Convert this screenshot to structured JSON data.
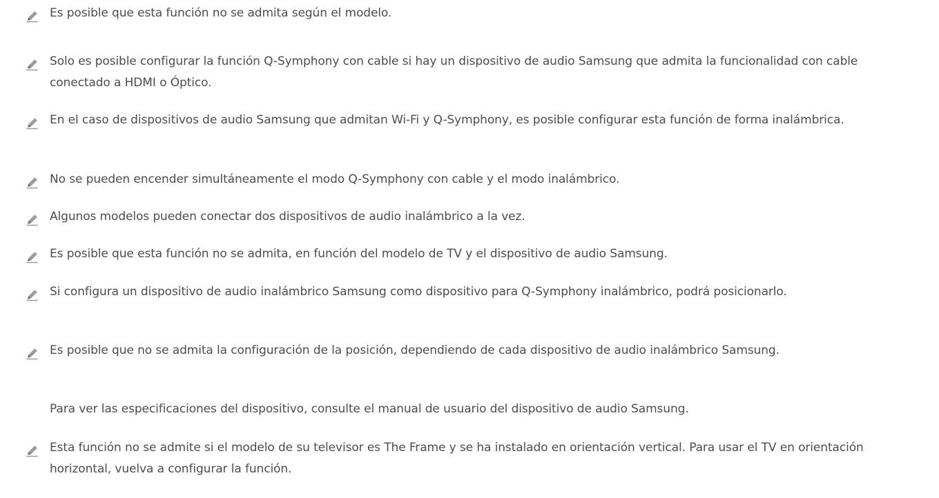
{
  "icon": {
    "name": "pencil-icon",
    "color": "#8a8a8a"
  },
  "notes": [
    {
      "text": "Es posible que esta función no se admita según el modelo."
    },
    {
      "text": "Solo es posible configurar la función Q-Symphony con cable si hay un dispositivo de audio Samsung que admita la funcionalidad con cable conectado a HDMI o Óptico."
    },
    {
      "text": "En el caso de dispositivos de audio Samsung que admitan Wi-Fi y Q-Symphony, es posible configurar esta función de forma inalámbrica."
    },
    {
      "text": "No se pueden encender simultáneamente el modo Q-Symphony con cable y el modo inalámbrico."
    },
    {
      "text": "Algunos modelos pueden conectar dos dispositivos de audio inalámbrico a la vez."
    },
    {
      "text": "Es posible que esta función no se admita, en función del modelo de TV y el dispositivo de audio Samsung."
    },
    {
      "text": "Si configura un dispositivo de audio inalámbrico Samsung como dispositivo para Q-Symphony inalámbrico, podrá posicionarlo."
    },
    {
      "text": "Es posible que no se admita la configuración de la posición, dependiendo de cada dispositivo de audio inalámbrico Samsung."
    },
    {
      "text": "Esta función no se admite si el modelo de su televisor es The Frame y se ha instalado en orientación vertical. Para usar el TV en orientación horizontal, vuelva a configurar la función."
    }
  ],
  "paragraph": {
    "text": "Para ver las especificaciones del dispositivo, consulte el manual de usuario del dispositivo de audio Samsung."
  }
}
